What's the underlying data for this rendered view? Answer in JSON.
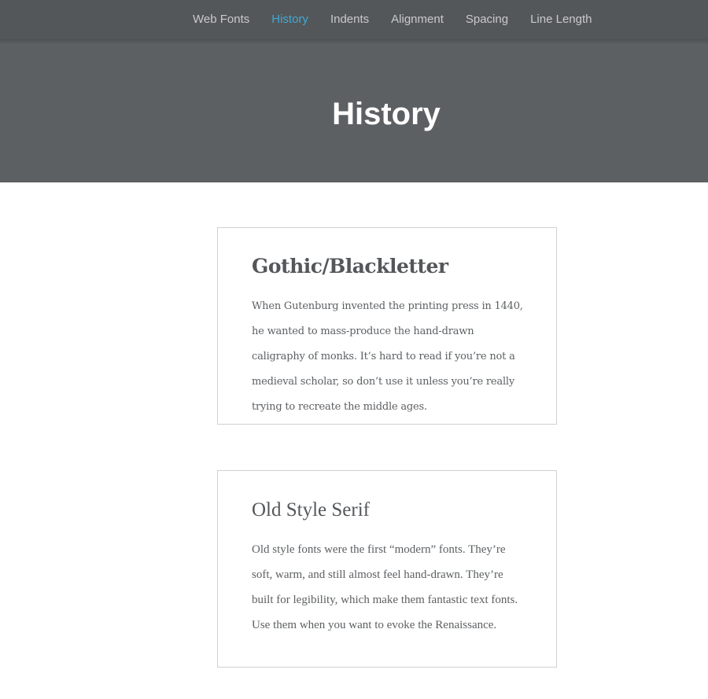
{
  "nav": {
    "items": [
      {
        "label": "Web Fonts",
        "active": false
      },
      {
        "label": "History",
        "active": true
      },
      {
        "label": "Indents",
        "active": false
      },
      {
        "label": "Alignment",
        "active": false
      },
      {
        "label": "Spacing",
        "active": false
      },
      {
        "label": "Line Length",
        "active": false
      }
    ]
  },
  "hero": {
    "title": "History"
  },
  "cards": [
    {
      "title": "Gothic/Blackletter",
      "text": "When Gutenburg invented the printing press in 1440, he wanted to mass-produce the hand-drawn caligraphy of monks. It’s hard to read if you’re not a medieval scholar, so don’t use it unless you’re really trying to recreate the middle ages."
    },
    {
      "title": "Old Style Serif",
      "text": "Old style fonts were the first “modern” fonts. They’re soft, warm, and still almost feel hand-drawn. They’re built for legibility, which make them fantastic text fonts. Use them when you want to evoke the Renaissance."
    }
  ],
  "colors": {
    "nav_bg": "#54575a",
    "hero_bg": "#5d6063",
    "active_link": "#3fa9d5"
  }
}
